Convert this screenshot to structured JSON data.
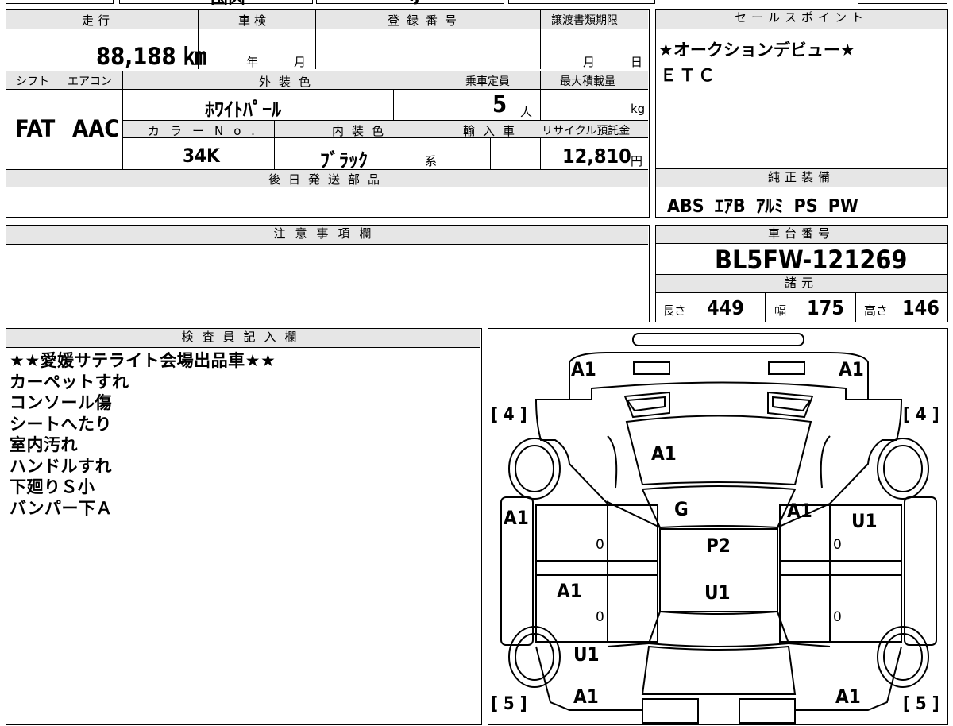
{
  "top_strip": {
    "frag1": "国内",
    "frag2": "ij"
  },
  "vehicle": {
    "mileage_label": "走行",
    "mileage_value": "88,188 ㎞",
    "inspection_label": "車検",
    "year_unit": "年",
    "month_unit": "月",
    "registration_label": "登録番号",
    "transfer_label": "譲渡書類期限",
    "day_unit": "日",
    "shift_label": "シフト",
    "shift_value": "FAT",
    "ac_label": "エアコン",
    "ac_value": "AAC",
    "exterior_label": "外装色",
    "exterior_value": "ﾎﾜｲﾄﾊﾟｰﾙ",
    "capacity_label": "乗車定員",
    "capacity_value": "5",
    "capacity_unit": "人",
    "maxload_label": "最大積載量",
    "maxload_unit": "kg",
    "color_no_label": "カラーNo.",
    "color_no_value": "34K",
    "interior_label": "内装色",
    "interior_value": "ﾌﾞﾗｯｸ",
    "interior_unit": "系",
    "import_label": "輸入車",
    "recycle_label": "リサイクル預託金",
    "recycle_value": "12,810",
    "recycle_unit": "円",
    "later_parts_label": "後日発送部品"
  },
  "sales_points": {
    "label": "セールスポイント",
    "lines": [
      "★オークションデビュー★",
      "ＥＴＣ"
    ]
  },
  "equipment": {
    "label": "純正装備",
    "value": "ABS ｴｱB ｱﾙﾐ PS PW"
  },
  "notice": {
    "label": "注意事項欄"
  },
  "chassis": {
    "label": "車台番号",
    "value": "BL5FW-121269"
  },
  "specs": {
    "label": "諸元",
    "length_label": "長さ",
    "length_value": "449",
    "width_label": "幅",
    "width_value": "175",
    "height_label": "高さ",
    "height_value": "146"
  },
  "inspector": {
    "label": "検査員記入欄",
    "notes": [
      "★★愛媛サテライト会場出品車★★",
      "カーペットすれ",
      "コンソール傷",
      "シートへたり",
      "室内汚れ",
      "ハンドルすれ",
      "下廻りＳ小",
      "バンパー下Ａ"
    ]
  },
  "diagram": {
    "marks": [
      "A1",
      "A1",
      "A1",
      "G",
      "A1",
      "U1",
      "A1",
      "P2",
      "A1",
      "U1",
      "U1",
      "A1",
      "A1"
    ],
    "zeros": [
      "0",
      "0",
      "0",
      "0"
    ],
    "tyre_front_left": "[ 4 ]",
    "tyre_front_right": "[ 4 ]",
    "tyre_rear_left": "[ 5 ]",
    "tyre_rear_right": "[ 5 ]"
  }
}
